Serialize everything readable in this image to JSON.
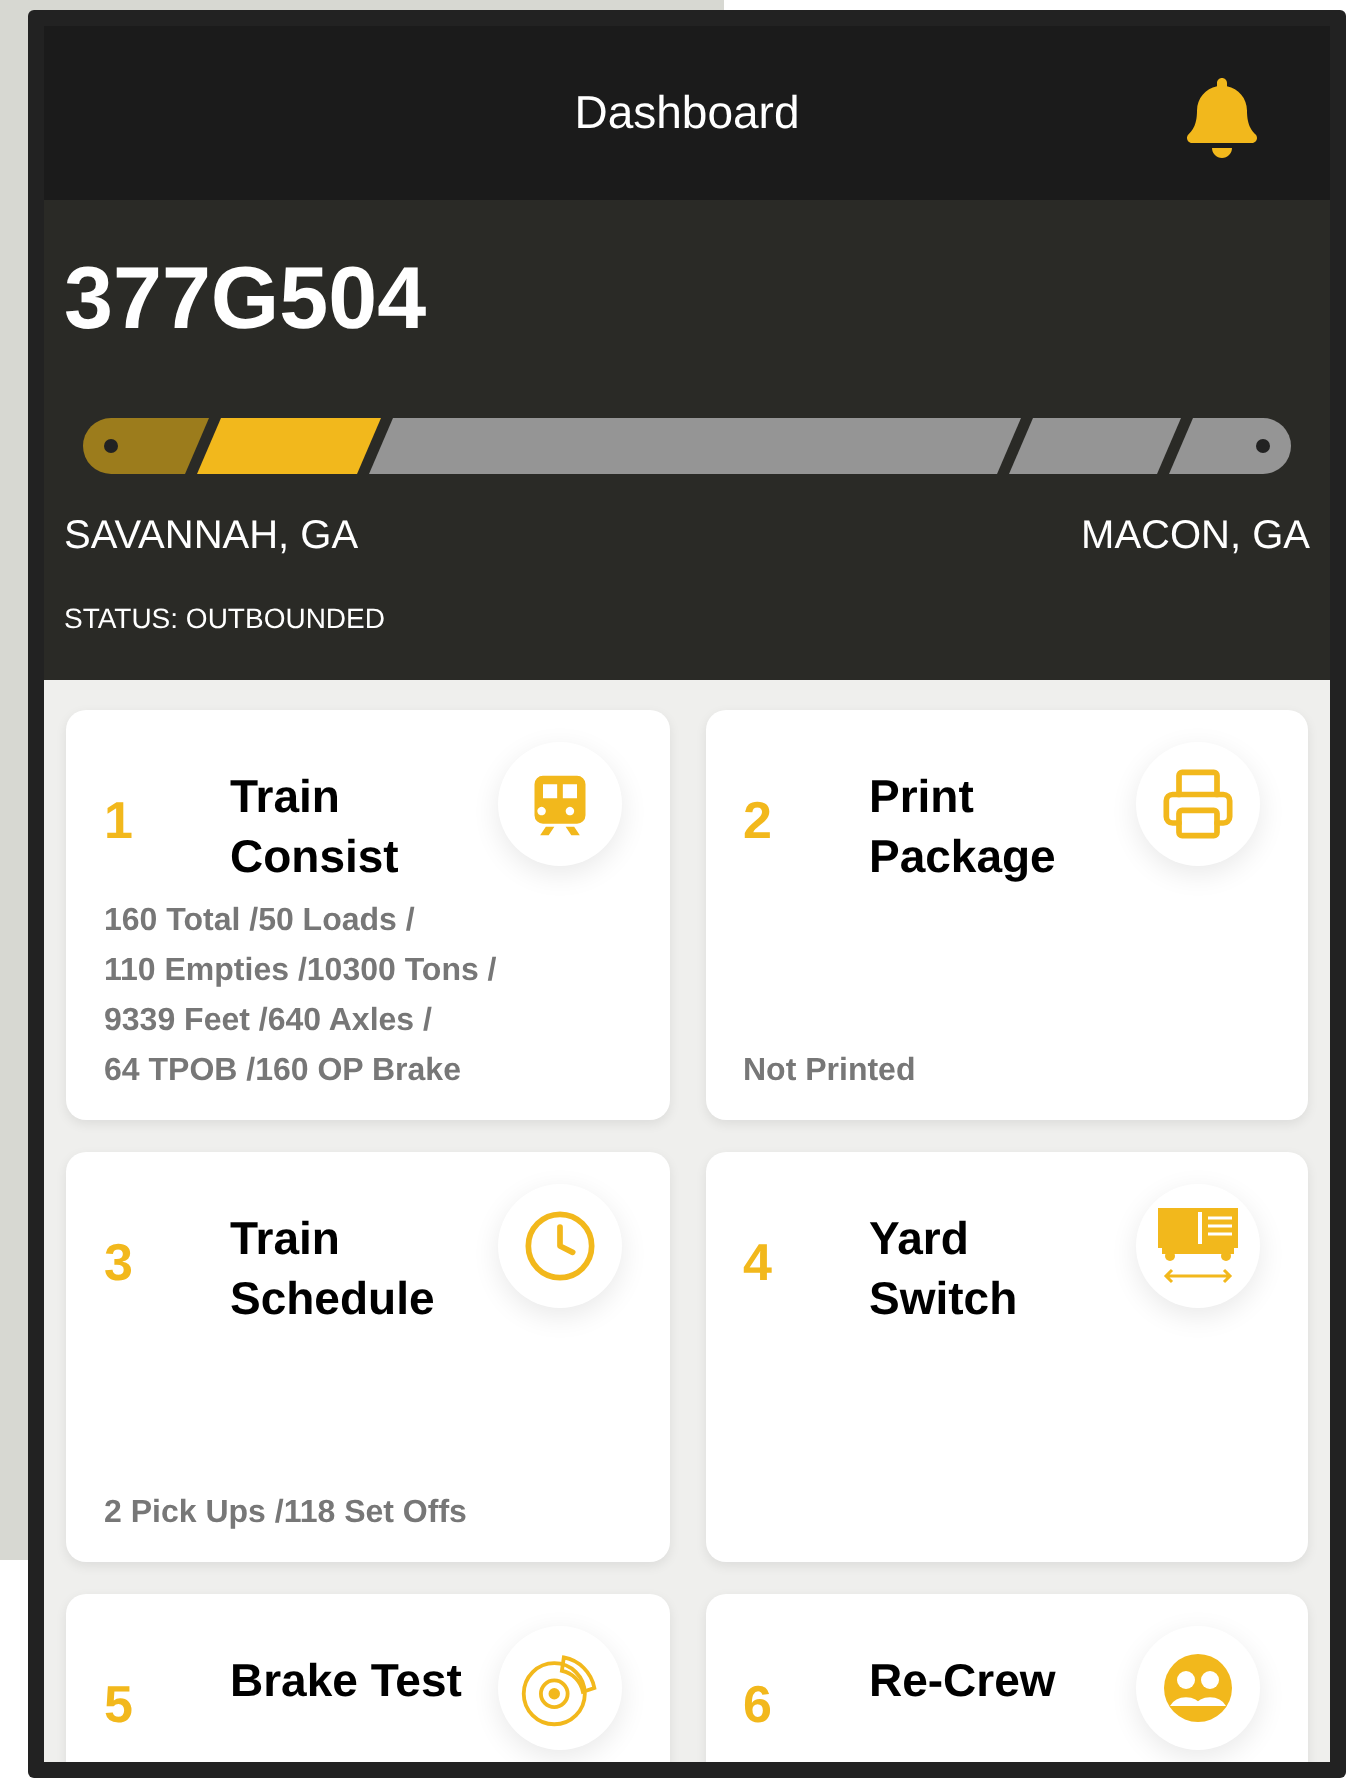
{
  "header": {
    "title": "Dashboard"
  },
  "train": {
    "id": "377G504",
    "origin": "SAVANNAH, GA",
    "destination": "MACON, GA",
    "status": "STATUS: OUTBOUNDED",
    "route_segments": [
      {
        "done": true,
        "current": false
      },
      {
        "done": false,
        "current": true
      },
      {
        "done": false,
        "current": false
      },
      {
        "done": false,
        "current": false
      },
      {
        "done": false,
        "current": false
      }
    ]
  },
  "cards": [
    {
      "number": "1",
      "title": [
        "Train",
        "Consist"
      ],
      "kind": "train",
      "details": [
        "160 Total /50 Loads /",
        "110 Empties /10300 Tons /",
        "9339 Feet /640 Axles /",
        "64 TPOB /160 OP Brake"
      ]
    },
    {
      "number": "2",
      "title": [
        "Print",
        "Package"
      ],
      "kind": "printer",
      "details": [
        "Not Printed"
      ]
    },
    {
      "number": "3",
      "title": [
        "Train",
        "Schedule"
      ],
      "kind": "clock",
      "details": [
        "2 Pick Ups /118 Set Offs"
      ]
    },
    {
      "number": "4",
      "title": [
        "Yard",
        "Switch"
      ],
      "kind": "railcar"
    },
    {
      "number": "5",
      "title": [
        "Brake Test"
      ],
      "kind": "brake"
    },
    {
      "number": "6",
      "title": [
        "Re-Crew"
      ],
      "kind": "crew"
    }
  ]
}
